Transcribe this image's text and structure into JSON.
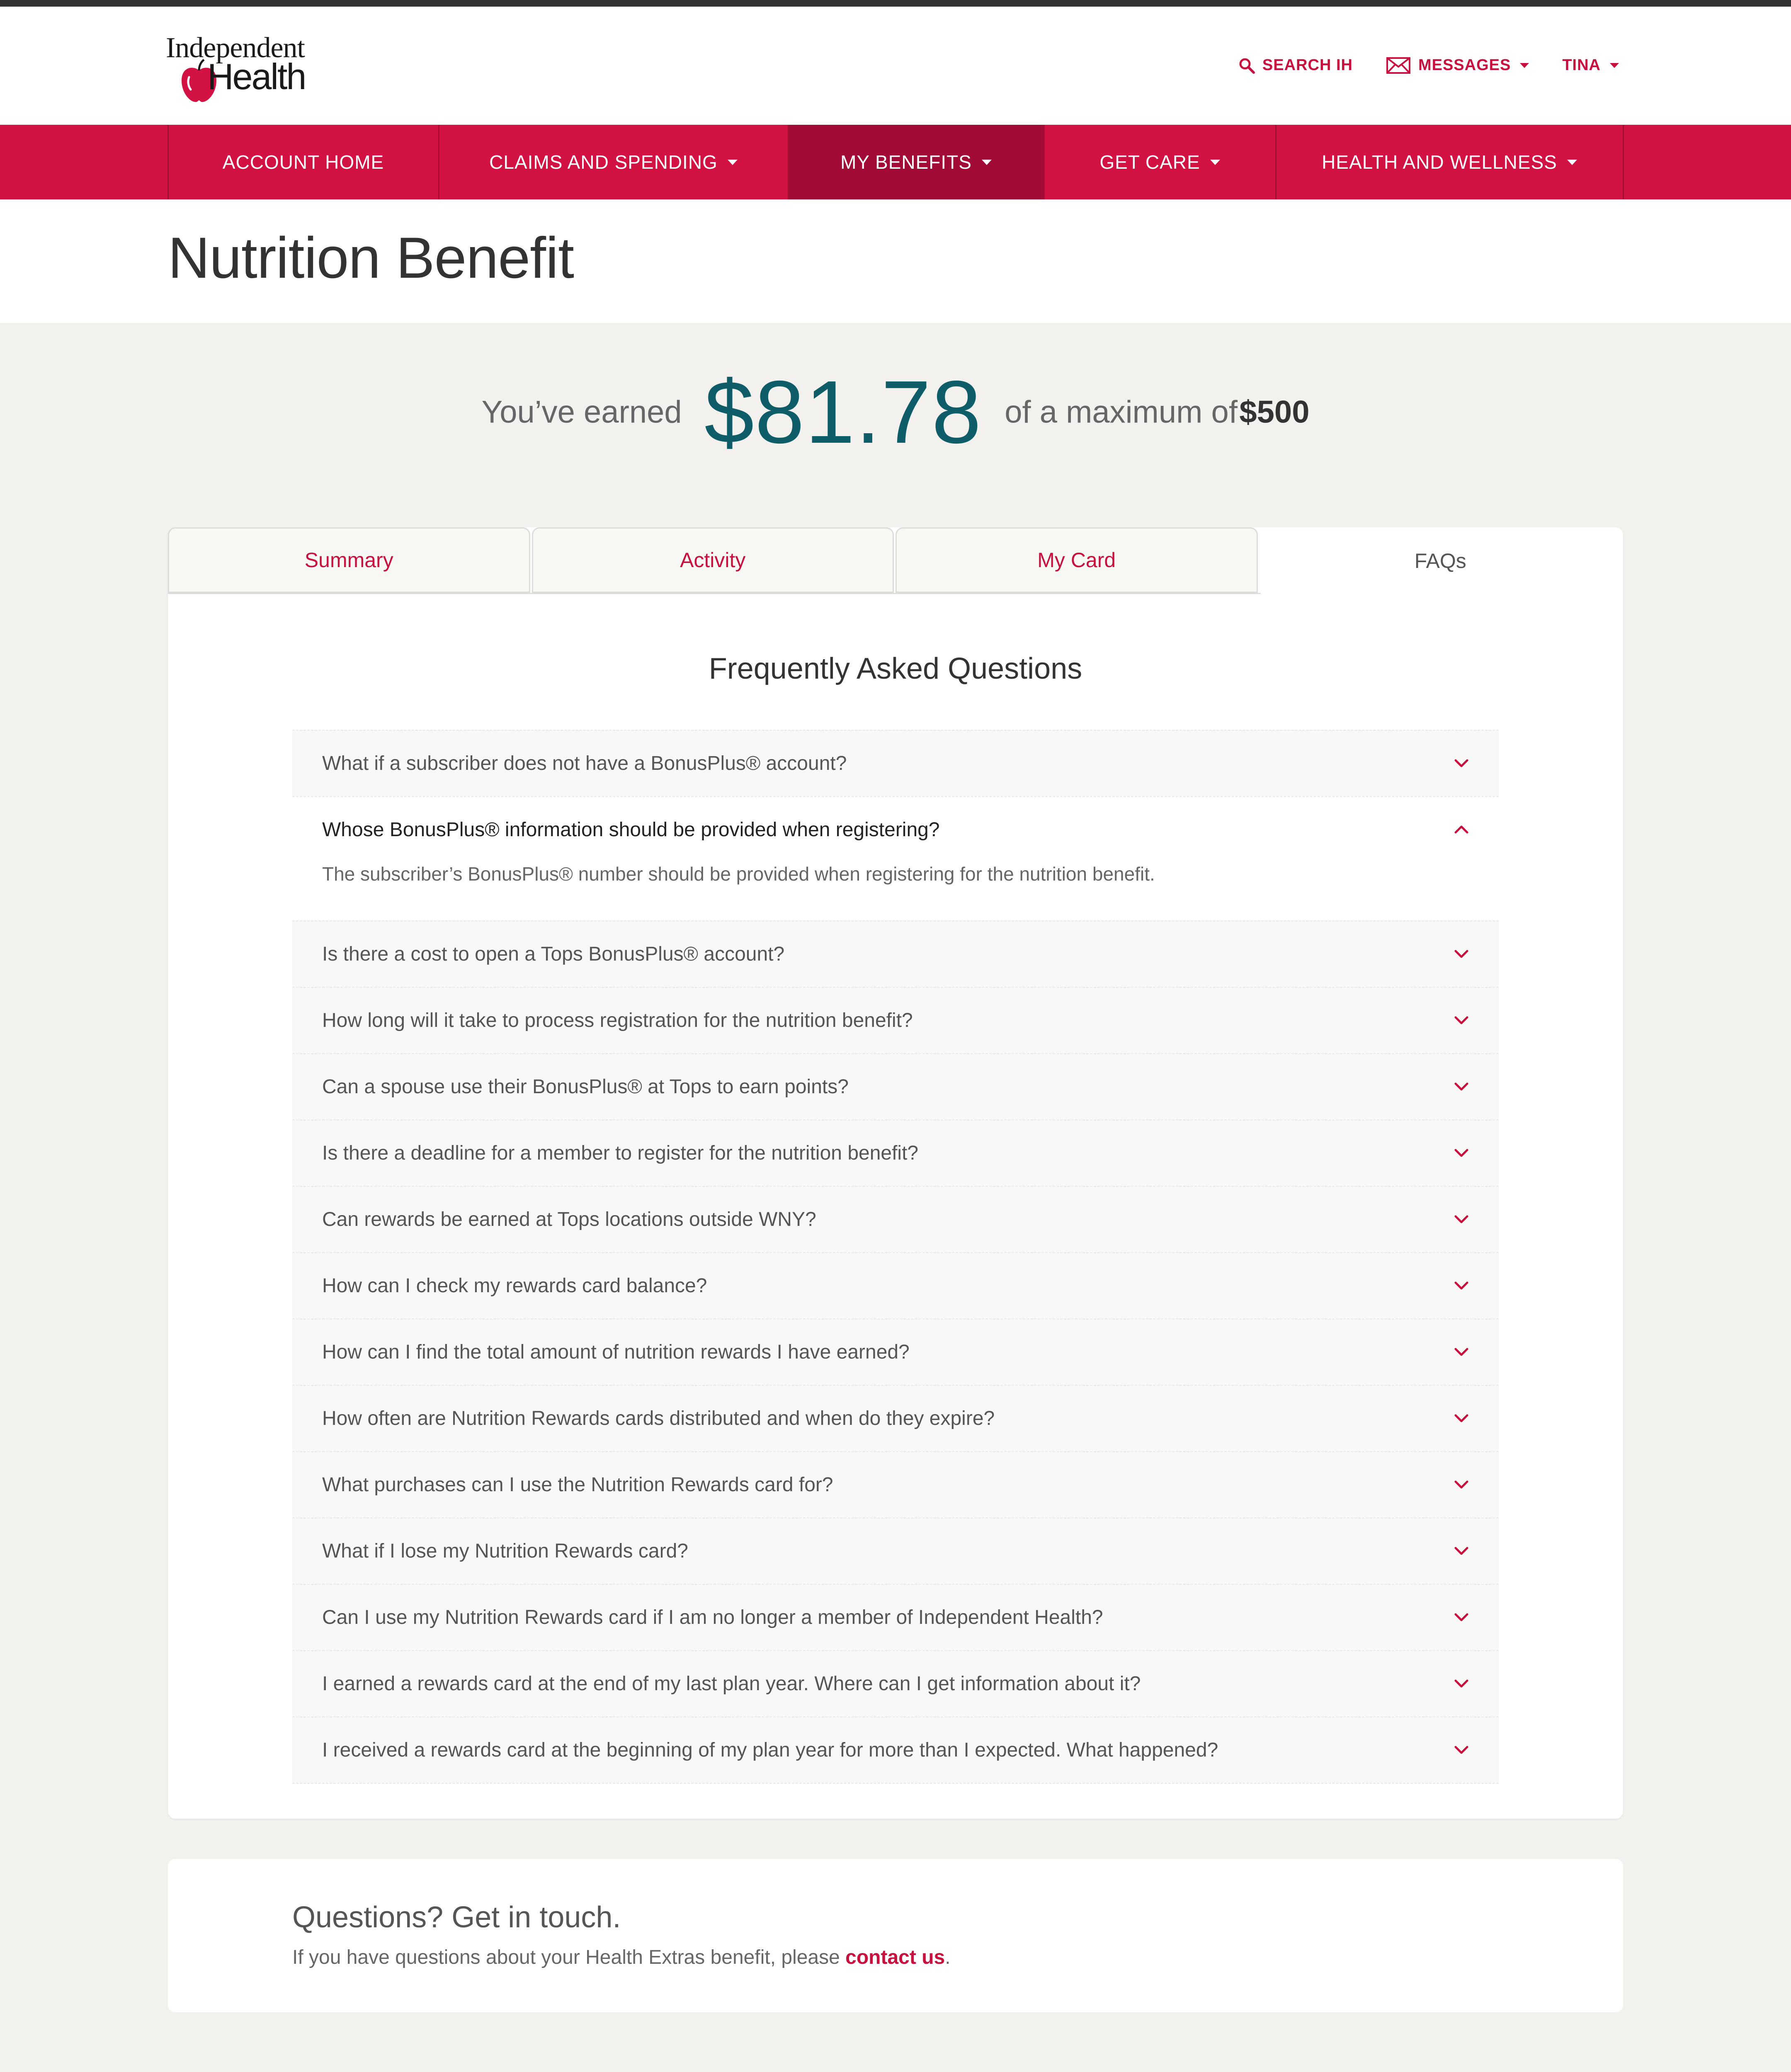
{
  "brand": {
    "logo_line1": "Independent",
    "logo_line2": "Health",
    "logo_mark": "®",
    "primary_color": "#d11242",
    "active_nav_color": "#a20b36",
    "amount_color": "#0e5d68",
    "link_color": "#c8103e"
  },
  "header": {
    "search_label": "SEARCH IH",
    "messages_label": "MESSAGES",
    "user_label": "TINA",
    "search_icon": "search-icon",
    "messages_icon": "envelope-icon"
  },
  "nav": {
    "items": [
      {
        "label": "ACCOUNT HOME",
        "dropdown": false,
        "active": false
      },
      {
        "label": "CLAIMS AND SPENDING",
        "dropdown": true,
        "active": false
      },
      {
        "label": "MY BENEFITS",
        "dropdown": true,
        "active": true
      },
      {
        "label": "GET CARE",
        "dropdown": true,
        "active": false
      },
      {
        "label": "HEALTH AND WELLNESS",
        "dropdown": true,
        "active": false
      }
    ]
  },
  "page": {
    "title": "Nutrition Benefit"
  },
  "earnings": {
    "prefix": "You’ve earned",
    "amount": "$81.78",
    "middle": "of a maximum of",
    "maximum": "$500"
  },
  "tabs": [
    {
      "label": "Summary",
      "active": false
    },
    {
      "label": "Activity",
      "active": false
    },
    {
      "label": "My Card",
      "active": false
    },
    {
      "label": "FAQs",
      "active": true
    }
  ],
  "faq": {
    "title": "Frequently Asked Questions",
    "items": [
      {
        "question": "What if a subscriber does not have a BonusPlus® account?",
        "open": false
      },
      {
        "question": "Whose BonusPlus® information should be provided when registering?",
        "open": true,
        "answer": "The subscriber’s BonusPlus® number should be provided when registering for the nutrition benefit."
      },
      {
        "question": "Is there a cost to open a Tops BonusPlus® account?",
        "open": false
      },
      {
        "question": "How long will it take to process registration for the nutrition benefit?",
        "open": false
      },
      {
        "question": "Can a spouse use their BonusPlus® at Tops to earn points?",
        "open": false
      },
      {
        "question": "Is there a deadline for a member to register for the nutrition benefit?",
        "open": false
      },
      {
        "question": "Can rewards be earned at Tops locations outside WNY?",
        "open": false
      },
      {
        "question": "How can I check my rewards card balance?",
        "open": false
      },
      {
        "question": "How can I find the total amount of nutrition rewards I have earned?",
        "open": false
      },
      {
        "question": "How often are Nutrition Rewards cards distributed and when do they expire?",
        "open": false
      },
      {
        "question": "What purchases can I use the Nutrition Rewards card for?",
        "open": false
      },
      {
        "question": "What if I lose my Nutrition Rewards card?",
        "open": false
      },
      {
        "question": "Can I use my Nutrition Rewards card if I am no longer a member of Independent Health?",
        "open": false
      },
      {
        "question": "I earned a rewards card at the end of my last plan year. Where can I get information about it?",
        "open": false
      },
      {
        "question": "I received a rewards card at the beginning of my plan year for more than I expected. What happened?",
        "open": false
      }
    ]
  },
  "contact": {
    "title": "Questions? Get in touch.",
    "text_before": "If you have questions about your Health Extras benefit, please ",
    "link_label": "contact us",
    "text_after": "."
  }
}
